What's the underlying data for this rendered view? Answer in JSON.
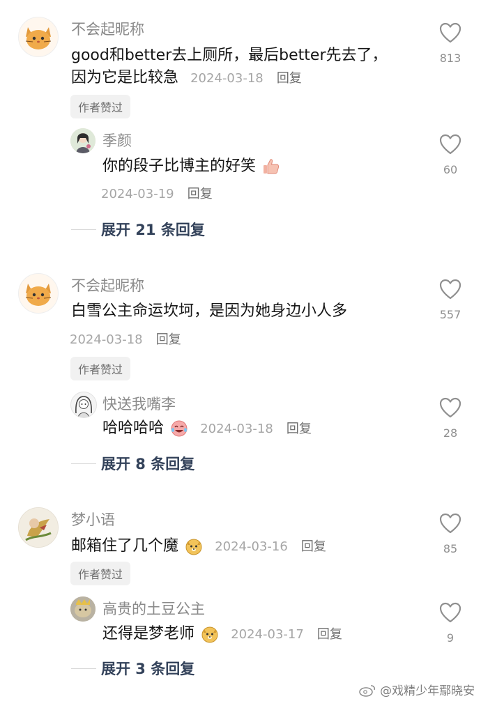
{
  "comments": [
    {
      "author": "不会起昵称",
      "text_line1": "good和better去上厕所，最后better先去了，",
      "text_line2": "因为它是比较急",
      "date": "2024-03-18",
      "reply_label": "回复",
      "badge": "作者赞过",
      "likes": "813",
      "avatar_icon": "cat-face",
      "sub_reply": {
        "author": "季颜",
        "text": "你的段子比博主的好笑",
        "emoji": "thumbs-up-icon",
        "date": "2024-03-19",
        "reply_label": "回复",
        "likes": "60"
      },
      "expand_label": "展开 21 条回复"
    },
    {
      "author": "不会起昵称",
      "text_line1": "白雪公主命运坎坷，是因为她身边小人多",
      "date": "2024-03-18",
      "reply_label": "回复",
      "badge": "作者赞过",
      "likes": "557",
      "avatar_icon": "cat-face",
      "sub_reply": {
        "author": "快送我嘴李",
        "text": "哈哈哈哈",
        "emoji": "laugh-cry-icon",
        "date": "2024-03-18",
        "reply_label": "回复",
        "likes": "28"
      },
      "expand_label": "展开 8 条回复"
    },
    {
      "author": "梦小语",
      "text_line1": "邮箱住了几个魔",
      "emoji": "doge-icon",
      "date": "2024-03-16",
      "reply_label": "回复",
      "badge": "作者赞过",
      "likes": "85",
      "sub_reply": {
        "author": "高贵的土豆公主",
        "text": "还得是梦老师",
        "emoji": "doge-icon",
        "date": "2024-03-17",
        "reply_label": "回复",
        "likes": "9"
      },
      "expand_label": "展开 3 条回复"
    }
  ],
  "watermark": "@戏精少年鄢晓安",
  "colors": {
    "text": "#161616",
    "muted": "#8a8a8a",
    "expand": "#33425a",
    "chip_bg": "#f1f1f1"
  }
}
